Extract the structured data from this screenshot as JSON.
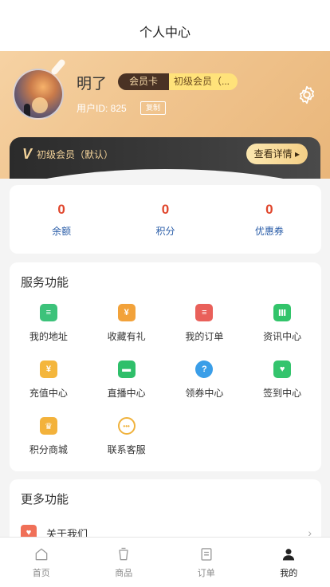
{
  "navbar": {
    "title": "个人中心"
  },
  "profile": {
    "username": "明了",
    "card_label": "会员卡",
    "level_tag": "初级会员（...",
    "user_id": "用户ID: 825",
    "copy_label": "复制"
  },
  "vip": {
    "badge": "V",
    "text": "初级会员（默认）",
    "detail_label": "查看详情 ▸"
  },
  "stats": [
    {
      "value": "0",
      "label": "余额"
    },
    {
      "value": "0",
      "label": "积分"
    },
    {
      "value": "0",
      "label": "优惠券"
    }
  ],
  "services": {
    "title": "服务功能",
    "items": [
      {
        "label": "我的地址",
        "icon": "address-icon",
        "color": "#3cc27a",
        "glyph": "≡"
      },
      {
        "label": "收藏有礼",
        "icon": "gift-icon",
        "color": "#f2a23a",
        "glyph": "¥"
      },
      {
        "label": "我的订单",
        "icon": "order-icon",
        "color": "#e9605a",
        "glyph": "≡"
      },
      {
        "label": "资讯中心",
        "icon": "news-icon",
        "color": "#32c46a",
        "glyph": "Ⅲ"
      },
      {
        "label": "充值中心",
        "icon": "recharge-icon",
        "color": "#f4b63c",
        "glyph": "¥"
      },
      {
        "label": "直播中心",
        "icon": "live-icon",
        "color": "#2fbf6a",
        "glyph": "▬"
      },
      {
        "label": "领券中心",
        "icon": "coupon-icon",
        "color": "#3a9ee8",
        "glyph": "?"
      },
      {
        "label": "签到中心",
        "icon": "checkin-icon",
        "color": "#34c46d",
        "glyph": "♥"
      },
      {
        "label": "积分商城",
        "icon": "crown-icon",
        "color": "#f3b23b",
        "glyph": "♛"
      },
      {
        "label": "联系客服",
        "icon": "service-icon",
        "color": "#f0b23c",
        "glyph": "•••"
      }
    ]
  },
  "more": {
    "title": "更多功能",
    "items": [
      {
        "label": "关于我们"
      }
    ]
  },
  "tabbar": [
    {
      "label": "首页",
      "icon": "home-icon",
      "active": false
    },
    {
      "label": "商品",
      "icon": "cup-icon",
      "active": false
    },
    {
      "label": "订单",
      "icon": "list-icon",
      "active": false
    },
    {
      "label": "我的",
      "icon": "user-icon",
      "active": true
    }
  ]
}
